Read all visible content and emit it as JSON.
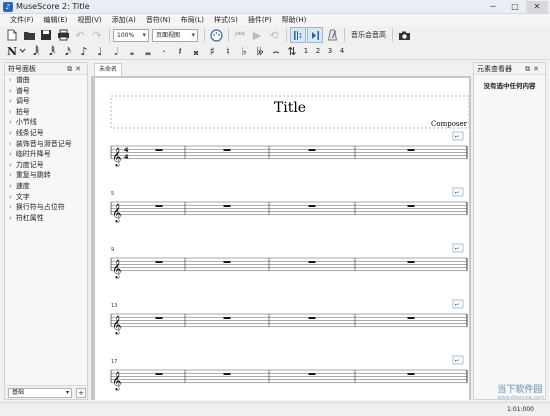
{
  "window": {
    "title": "MuseScore 2: Title"
  },
  "menu": [
    "文件(F)",
    "编辑(E)",
    "视图(V)",
    "添加(A)",
    "音符(N)",
    "布局(L)",
    "样式(S)",
    "插件(P)",
    "帮助(H)"
  ],
  "toolbar": {
    "zoom_value": "100%",
    "view_mode": "页面视图",
    "concert_pitch_label": "音乐会音高"
  },
  "note_toolbar": {
    "voices": [
      "1",
      "2",
      "3",
      "4"
    ]
  },
  "palette": {
    "title": "符号面板",
    "items": [
      "谱曲",
      "谱号",
      "调号",
      "拍号",
      "小节线",
      "线条记号",
      "装饰音与滑音记号",
      "临时升降号",
      "力度记号",
      "重复与跳转",
      "速度",
      "文字",
      "换行符与占位符",
      "符杠属性"
    ],
    "workspace": "基础"
  },
  "score": {
    "tab_name": "未命名",
    "title": "Title",
    "composer": "Composer",
    "measure_numbers": [
      "5",
      "9",
      "13",
      "17"
    ]
  },
  "inspector": {
    "title": "元素查看器",
    "empty_message": "没有选中任何内容"
  },
  "status": {
    "position": "1:01:000"
  },
  "watermark": {
    "text": "当下软件园",
    "url": "www.downxia.com"
  }
}
